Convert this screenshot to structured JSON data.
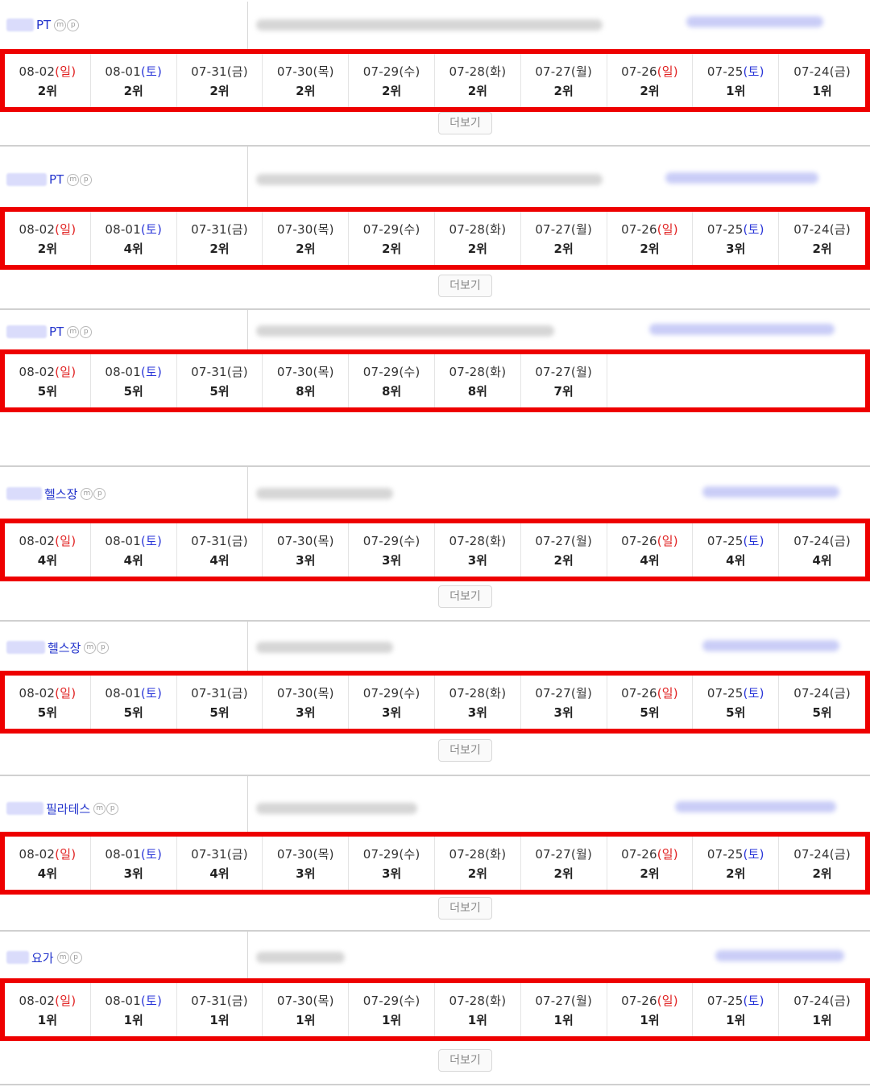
{
  "icons": {
    "m": "m",
    "p": "p"
  },
  "more_label": "더보기",
  "sections": [
    {
      "keyword": "PT",
      "cells": [
        {
          "date": "08-02",
          "day": "일",
          "type": "sun",
          "rank": "2위"
        },
        {
          "date": "08-01",
          "day": "토",
          "type": "sat",
          "rank": "2위"
        },
        {
          "date": "07-31",
          "day": "금",
          "type": "wk",
          "rank": "2위"
        },
        {
          "date": "07-30",
          "day": "목",
          "type": "wk",
          "rank": "2위"
        },
        {
          "date": "07-29",
          "day": "수",
          "type": "wk",
          "rank": "2위"
        },
        {
          "date": "07-28",
          "day": "화",
          "type": "wk",
          "rank": "2위"
        },
        {
          "date": "07-27",
          "day": "월",
          "type": "wk",
          "rank": "2위"
        },
        {
          "date": "07-26",
          "day": "일",
          "type": "sun",
          "rank": "2위"
        },
        {
          "date": "07-25",
          "day": "토",
          "type": "sat",
          "rank": "1위"
        },
        {
          "date": "07-24",
          "day": "금",
          "type": "wk",
          "rank": "1위"
        }
      ]
    },
    {
      "keyword": "PT",
      "cells": [
        {
          "date": "08-02",
          "day": "일",
          "type": "sun",
          "rank": "2위"
        },
        {
          "date": "08-01",
          "day": "토",
          "type": "sat",
          "rank": "4위"
        },
        {
          "date": "07-31",
          "day": "금",
          "type": "wk",
          "rank": "2위"
        },
        {
          "date": "07-30",
          "day": "목",
          "type": "wk",
          "rank": "2위"
        },
        {
          "date": "07-29",
          "day": "수",
          "type": "wk",
          "rank": "2위"
        },
        {
          "date": "07-28",
          "day": "화",
          "type": "wk",
          "rank": "2위"
        },
        {
          "date": "07-27",
          "day": "월",
          "type": "wk",
          "rank": "2위"
        },
        {
          "date": "07-26",
          "day": "일",
          "type": "sun",
          "rank": "2위"
        },
        {
          "date": "07-25",
          "day": "토",
          "type": "sat",
          "rank": "3위"
        },
        {
          "date": "07-24",
          "day": "금",
          "type": "wk",
          "rank": "2위"
        }
      ]
    },
    {
      "keyword": "PT",
      "cells": [
        {
          "date": "08-02",
          "day": "일",
          "type": "sun",
          "rank": "5위"
        },
        {
          "date": "08-01",
          "day": "토",
          "type": "sat",
          "rank": "5위"
        },
        {
          "date": "07-31",
          "day": "금",
          "type": "wk",
          "rank": "5위"
        },
        {
          "date": "07-30",
          "day": "목",
          "type": "wk",
          "rank": "8위"
        },
        {
          "date": "07-29",
          "day": "수",
          "type": "wk",
          "rank": "8위"
        },
        {
          "date": "07-28",
          "day": "화",
          "type": "wk",
          "rank": "8위"
        },
        {
          "date": "07-27",
          "day": "월",
          "type": "wk",
          "rank": "7위"
        }
      ]
    },
    {
      "keyword": "헬스장",
      "cells": [
        {
          "date": "08-02",
          "day": "일",
          "type": "sun",
          "rank": "4위"
        },
        {
          "date": "08-01",
          "day": "토",
          "type": "sat",
          "rank": "4위"
        },
        {
          "date": "07-31",
          "day": "금",
          "type": "wk",
          "rank": "4위"
        },
        {
          "date": "07-30",
          "day": "목",
          "type": "wk",
          "rank": "3위"
        },
        {
          "date": "07-29",
          "day": "수",
          "type": "wk",
          "rank": "3위"
        },
        {
          "date": "07-28",
          "day": "화",
          "type": "wk",
          "rank": "3위"
        },
        {
          "date": "07-27",
          "day": "월",
          "type": "wk",
          "rank": "2위"
        },
        {
          "date": "07-26",
          "day": "일",
          "type": "sun",
          "rank": "4위"
        },
        {
          "date": "07-25",
          "day": "토",
          "type": "sat",
          "rank": "4위"
        },
        {
          "date": "07-24",
          "day": "금",
          "type": "wk",
          "rank": "4위"
        }
      ]
    },
    {
      "keyword": "헬스장",
      "cells": [
        {
          "date": "08-02",
          "day": "일",
          "type": "sun",
          "rank": "5위"
        },
        {
          "date": "08-01",
          "day": "토",
          "type": "sat",
          "rank": "5위"
        },
        {
          "date": "07-31",
          "day": "금",
          "type": "wk",
          "rank": "5위"
        },
        {
          "date": "07-30",
          "day": "목",
          "type": "wk",
          "rank": "3위"
        },
        {
          "date": "07-29",
          "day": "수",
          "type": "wk",
          "rank": "3위"
        },
        {
          "date": "07-28",
          "day": "화",
          "type": "wk",
          "rank": "3위"
        },
        {
          "date": "07-27",
          "day": "월",
          "type": "wk",
          "rank": "3위"
        },
        {
          "date": "07-26",
          "day": "일",
          "type": "sun",
          "rank": "5위"
        },
        {
          "date": "07-25",
          "day": "토",
          "type": "sat",
          "rank": "5위"
        },
        {
          "date": "07-24",
          "day": "금",
          "type": "wk",
          "rank": "5위"
        }
      ]
    },
    {
      "keyword": "필라테스",
      "cells": [
        {
          "date": "08-02",
          "day": "일",
          "type": "sun",
          "rank": "4위"
        },
        {
          "date": "08-01",
          "day": "토",
          "type": "sat",
          "rank": "3위"
        },
        {
          "date": "07-31",
          "day": "금",
          "type": "wk",
          "rank": "4위"
        },
        {
          "date": "07-30",
          "day": "목",
          "type": "wk",
          "rank": "3위"
        },
        {
          "date": "07-29",
          "day": "수",
          "type": "wk",
          "rank": "3위"
        },
        {
          "date": "07-28",
          "day": "화",
          "type": "wk",
          "rank": "2위"
        },
        {
          "date": "07-27",
          "day": "월",
          "type": "wk",
          "rank": "2위"
        },
        {
          "date": "07-26",
          "day": "일",
          "type": "sun",
          "rank": "2위"
        },
        {
          "date": "07-25",
          "day": "토",
          "type": "sat",
          "rank": "2위"
        },
        {
          "date": "07-24",
          "day": "금",
          "type": "wk",
          "rank": "2위"
        }
      ]
    },
    {
      "keyword": "요가",
      "cells": [
        {
          "date": "08-02",
          "day": "일",
          "type": "sun",
          "rank": "1위"
        },
        {
          "date": "08-01",
          "day": "토",
          "type": "sat",
          "rank": "1위"
        },
        {
          "date": "07-31",
          "day": "금",
          "type": "wk",
          "rank": "1위"
        },
        {
          "date": "07-30",
          "day": "목",
          "type": "wk",
          "rank": "1위"
        },
        {
          "date": "07-29",
          "day": "수",
          "type": "wk",
          "rank": "1위"
        },
        {
          "date": "07-28",
          "day": "화",
          "type": "wk",
          "rank": "1위"
        },
        {
          "date": "07-27",
          "day": "월",
          "type": "wk",
          "rank": "1위"
        },
        {
          "date": "07-26",
          "day": "일",
          "type": "sun",
          "rank": "1위"
        },
        {
          "date": "07-25",
          "day": "토",
          "type": "sat",
          "rank": "1위"
        },
        {
          "date": "07-24",
          "day": "금",
          "type": "wk",
          "rank": "1위"
        }
      ]
    }
  ],
  "colors": {
    "sunday": "#e02020",
    "saturday": "#2a36d8",
    "highlight_border": "#ee0000",
    "keyword": "#2233cc"
  }
}
